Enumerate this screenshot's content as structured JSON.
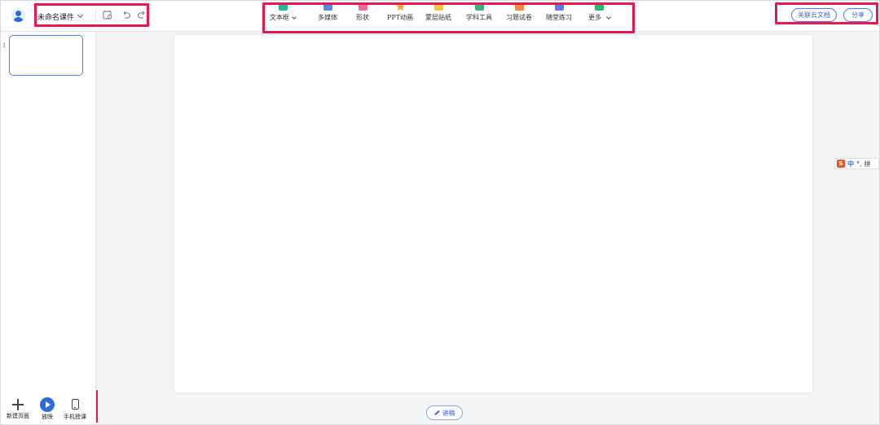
{
  "header": {
    "doc_title": "未命名课件"
  },
  "toolbar": {
    "items": [
      {
        "label": "文本框",
        "icon": "text-box-icon",
        "color": "#1fb89a",
        "dropdown": true
      },
      {
        "label": "多媒体",
        "icon": "media-icon",
        "color": "#4a8cf0",
        "dropdown": false
      },
      {
        "label": "形状",
        "icon": "shape-icon",
        "color": "#f06aa0",
        "dropdown": false
      },
      {
        "label": "PPT动画",
        "icon": "animation-star-icon",
        "color": "#f5a623",
        "dropdown": false
      },
      {
        "label": "蒙层贴纸",
        "icon": "sticker-icon",
        "color": "#f7c531",
        "dropdown": false
      },
      {
        "label": "学科工具",
        "icon": "books-icon",
        "color": "#2fb872",
        "dropdown": false
      },
      {
        "label": "习题试卷",
        "icon": "exam-icon",
        "color": "#f08a3c",
        "dropdown": false
      },
      {
        "label": "随堂练习",
        "icon": "practice-icon",
        "color": "#5b7cf2",
        "dropdown": false
      },
      {
        "label": "更多",
        "icon": "more-toolbox-icon",
        "color": "#2fb872",
        "dropdown": true
      }
    ]
  },
  "right_actions": {
    "link_cloud": "关联云文档",
    "share": "分享"
  },
  "slides": {
    "current_number": "1"
  },
  "bottom_tools": {
    "new_page": "新建页面",
    "play": "放映",
    "mobile_teaching": "手机授课"
  },
  "notes": {
    "label": "讲稿"
  },
  "ime": {
    "mode": "中",
    "punct": "°,",
    "pinyin": "拼"
  },
  "colors": {
    "accent": "#2d6cdf",
    "highlight_box": "#e8194f"
  }
}
